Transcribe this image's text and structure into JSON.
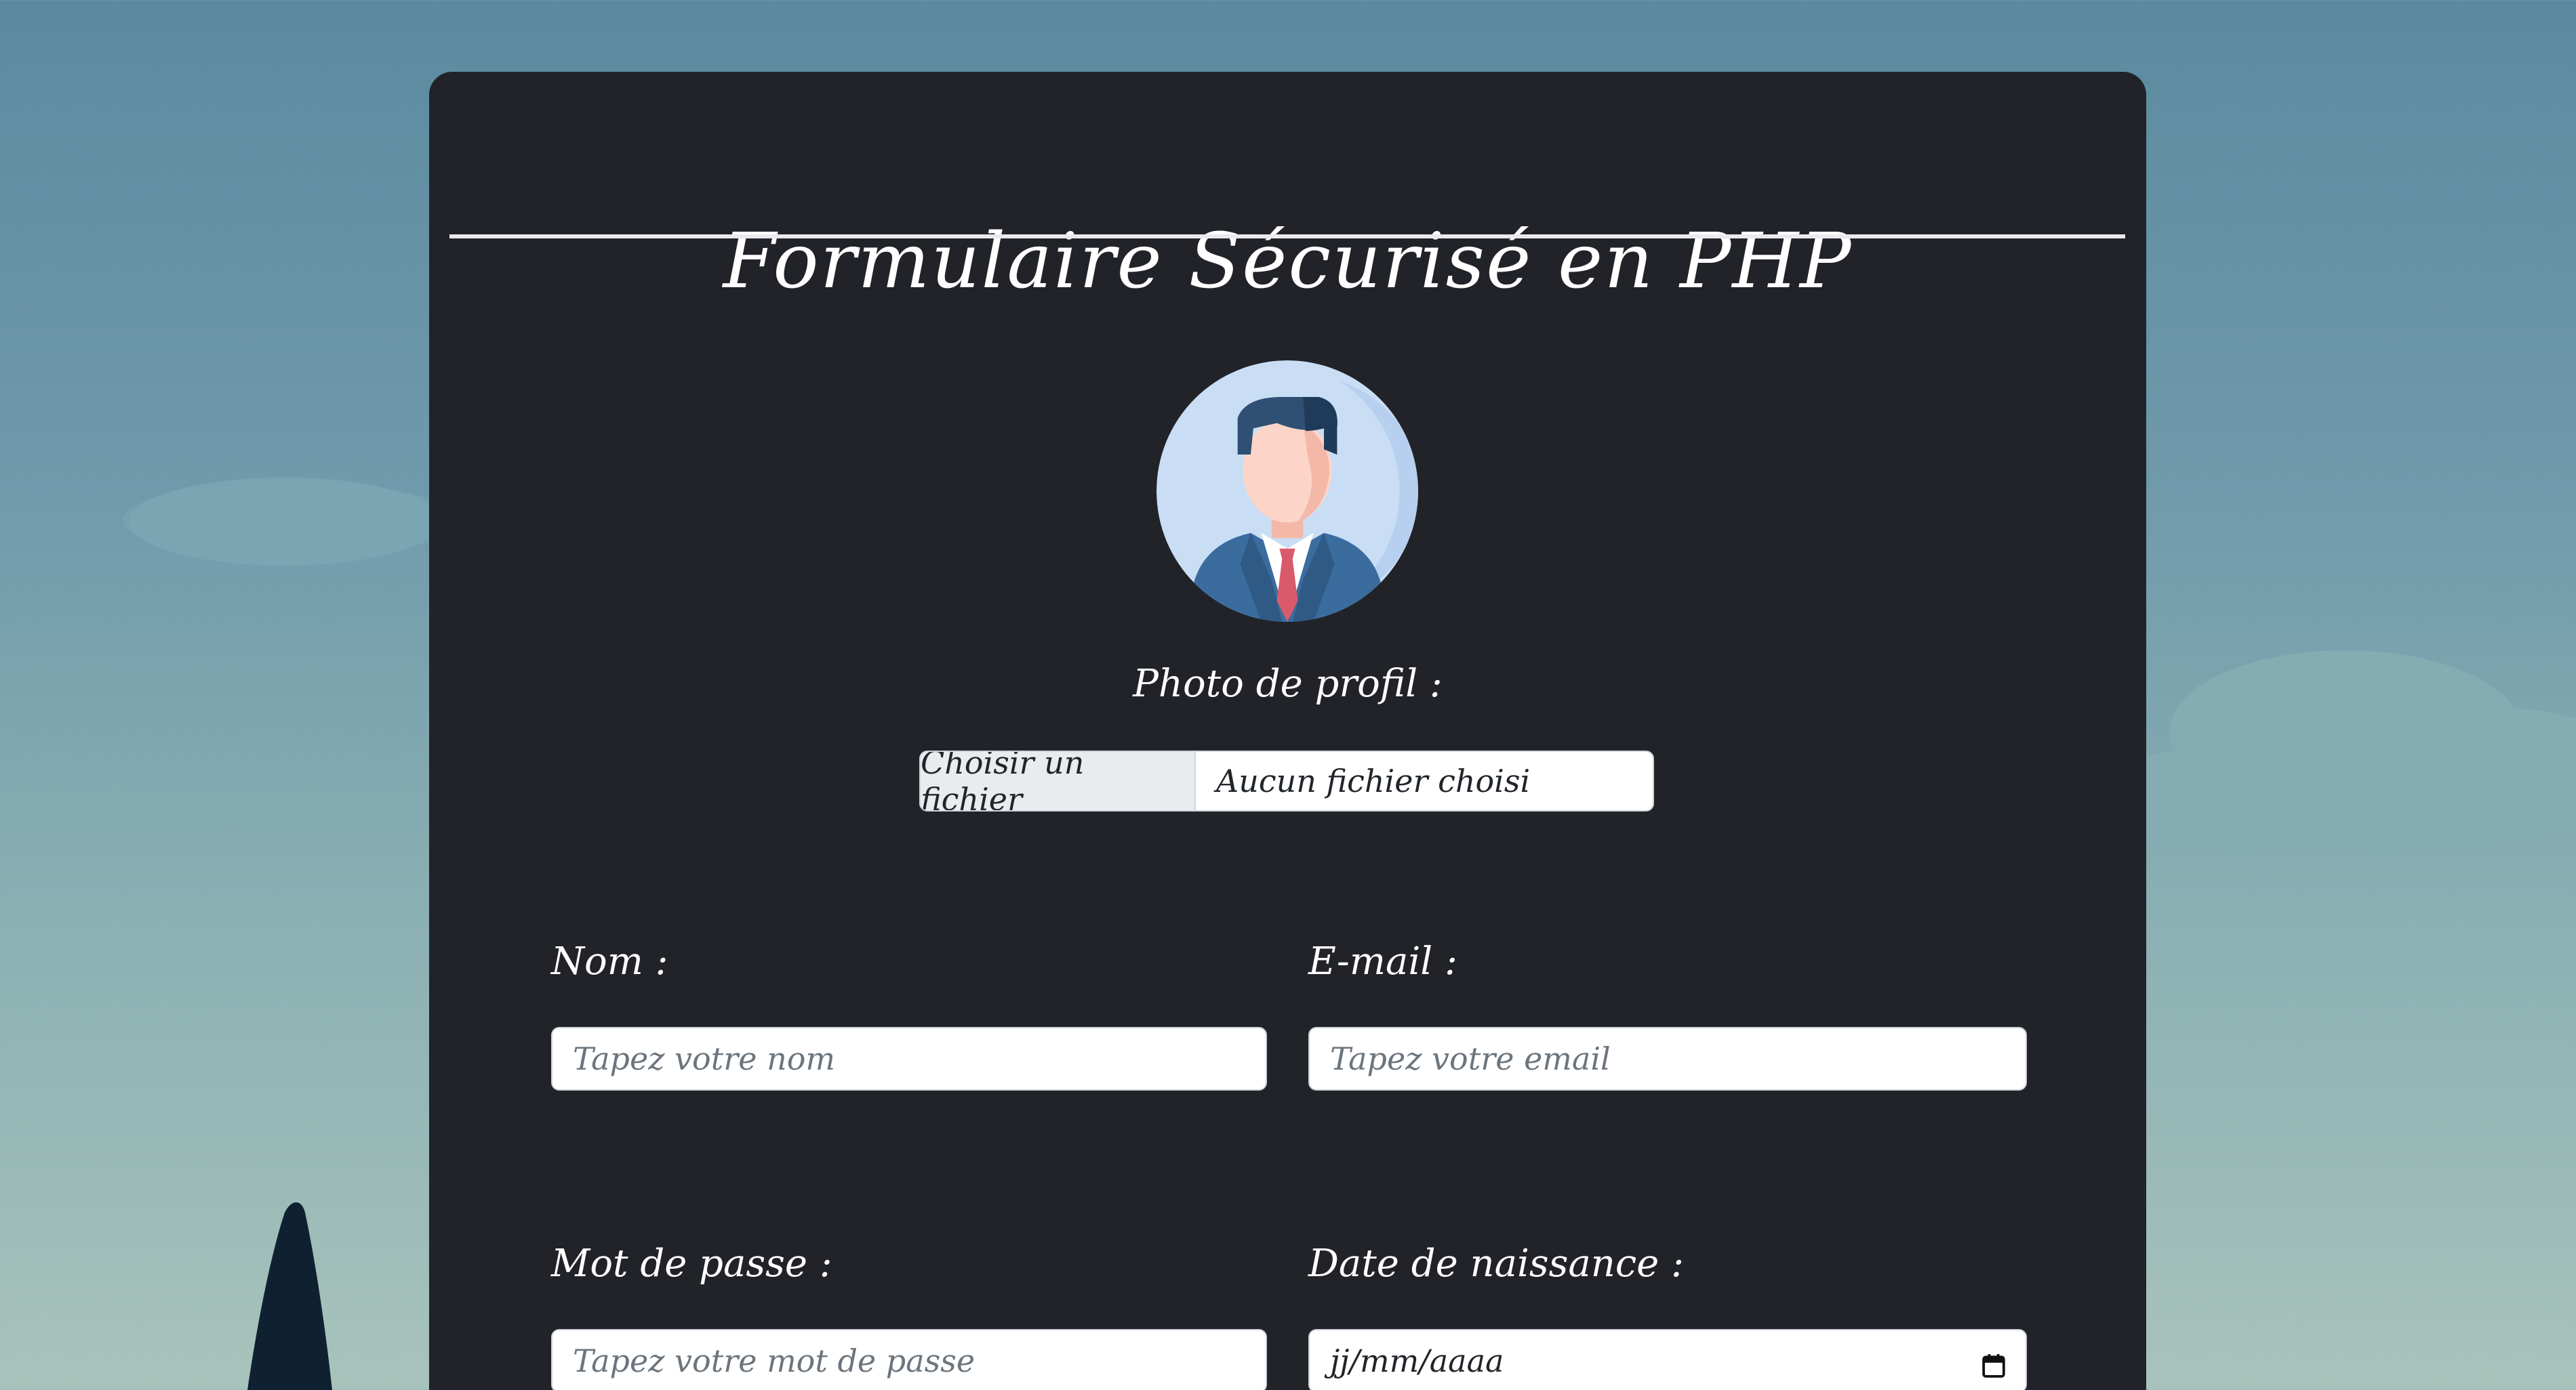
{
  "form": {
    "title": "Formulaire Sécurisé en PHP",
    "profile_photo_label": "Photo de profil :",
    "file_button_label": "Choisir un fichier",
    "file_status": "Aucun fichier choisi",
    "name_label": "Nom :",
    "name_placeholder": "Tapez votre nom",
    "email_label": "E-mail :",
    "email_placeholder": "Tapez votre email",
    "password_label": "Mot de passe :",
    "password_placeholder": "Tapez votre mot de passe",
    "birthdate_label": "Date de naissance :",
    "birthdate_placeholder": "jj/mm/aaaa"
  },
  "icons": {
    "avatar": "businessman-avatar-icon",
    "calendar": "calendar-icon"
  },
  "colors": {
    "card_background": "#212328",
    "avatar_background": "#c9def5",
    "suit": "#3b6c9e",
    "tie": "#d95a6a"
  }
}
